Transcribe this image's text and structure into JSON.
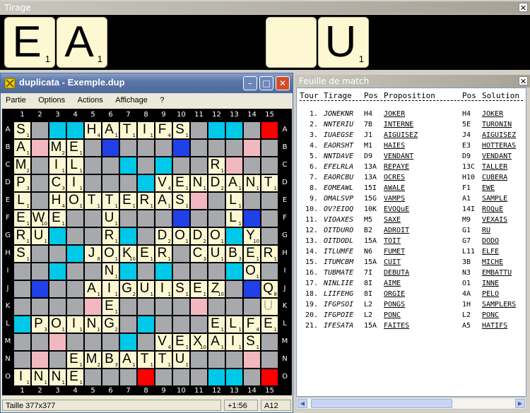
{
  "rack": {
    "title": "Tirage",
    "close": "✕",
    "tiles": [
      {
        "letter": "E",
        "value": "1"
      },
      {
        "letter": "A",
        "value": "1"
      },
      {
        "letter": "",
        "value": ""
      },
      {
        "letter": "",
        "value": ""
      },
      {
        "letter": "",
        "value": ""
      },
      {
        "letter": "",
        "value": ""
      },
      {
        "letter": "U",
        "value": "1"
      }
    ]
  },
  "duplicata": {
    "title": "duplicata - Exemple.dup",
    "buttons": {
      "minimize": "–",
      "maximize": "□",
      "close": "✕"
    },
    "menu": [
      "Partie",
      "Options",
      "Actions",
      "Affichage",
      "?"
    ],
    "columns": [
      "1",
      "2",
      "3",
      "4",
      "5",
      "6",
      "7",
      "8",
      "9",
      "10",
      "11",
      "12",
      "13",
      "14",
      "15"
    ],
    "rows": [
      "A",
      "B",
      "C",
      "D",
      "E",
      "F",
      "G",
      "H",
      "I",
      "J",
      "K",
      "L",
      "M",
      "N",
      "O"
    ],
    "board": [
      "S...HATIFS.....",
      "A.ME...........",
      "M.IL.......R...",
      "P.CI....VENDANT",
      "L.HOTTERAS..L..",
      "EWE..U......L..",
      "RU...R..DODO.Y.",
      "S...JOKER.CUBERA",
      ".....N.......O.",
      "....AIGUISEZ..Q",
      ".....E........u",
      ".POING.....ELFE",
      "........VEXAIS.",
      "...EMBATTU.....",
      "INNE..........."
    ],
    "status": {
      "size": "Taille 377x377",
      "time": "+1:56",
      "pos": "A12"
    }
  },
  "match": {
    "title": "Feuille de match",
    "close": "✕",
    "headers": {
      "tour": "Tour",
      "tirage": "Tirage",
      "pos": "Pos",
      "proposition": "Proposition",
      "pos2": "Pos",
      "solution": "Solution"
    },
    "rows": [
      {
        "n": "1.",
        "tirage": "JONEKNR",
        "pos": "H4",
        "prop": "JOKER",
        "pos2": "H4",
        "sol": "JOKER"
      },
      {
        "n": "2.",
        "tirage": "NNTERIU",
        "pos": "7B",
        "prop": "INTERNE",
        "pos2": "5E",
        "sol": "TURONIN"
      },
      {
        "n": "3.",
        "tirage": "IUAEGSE",
        "pos": "J1",
        "prop": "AIGUISEZ",
        "pos2": "J4",
        "sol": "AIGUISEZ"
      },
      {
        "n": "4.",
        "tirage": "EAORSHT",
        "pos": "M1",
        "prop": "HAIES",
        "pos2": "E3",
        "sol": "HOTTERAS"
      },
      {
        "n": "5.",
        "tirage": "NNTDAVE",
        "pos": "D9",
        "prop": "VENDANT",
        "pos2": "D9",
        "sol": "VENDANT"
      },
      {
        "n": "6.",
        "tirage": "EFELRLA",
        "pos": "13A",
        "prop": "REPAYE",
        "pos2": "13C",
        "sol": "TALLER"
      },
      {
        "n": "7.",
        "tirage": "EAORCBU",
        "pos": "13A",
        "prop": "OCRES",
        "pos2": "H10",
        "sol": "CUBERA"
      },
      {
        "n": "8.",
        "tirage": "EOMEAWL",
        "pos": "15I",
        "prop": "AWALE",
        "pos2": "F1",
        "sol": "EWE"
      },
      {
        "n": "9.",
        "tirage": "OMALSVP",
        "pos": "15G",
        "prop": "VAMPS",
        "pos2": "A1",
        "sol": "SAMPLE"
      },
      {
        "n": "10.",
        "tirage": "OV?EIOQ",
        "pos": "10K",
        "prop": "EVOQuE",
        "pos2": "14I",
        "sol": "ROQuE"
      },
      {
        "n": "11.",
        "tirage": "VIOAXES",
        "pos": "M5",
        "prop": "SAXE",
        "pos2": "M9",
        "sol": "VEXAIS"
      },
      {
        "n": "12.",
        "tirage": "OITDURO",
        "pos": "B2",
        "prop": "ADROIT",
        "pos2": "G1",
        "sol": "RU"
      },
      {
        "n": "13.",
        "tirage": "OITDODL",
        "pos": "15A",
        "prop": "TOIT",
        "pos2": "G7",
        "sol": "DODO"
      },
      {
        "n": "14.",
        "tirage": "ITLUMFE",
        "pos": "N6",
        "prop": "FUMET",
        "pos2": "L11",
        "sol": "ELFE"
      },
      {
        "n": "15.",
        "tirage": "ITUMCBM",
        "pos": "15A",
        "prop": "CUIT",
        "pos2": "3B",
        "sol": "MICHE"
      },
      {
        "n": "16.",
        "tirage": "TUBMATE",
        "pos": "7I",
        "prop": "DEBUTA",
        "pos2": "N3",
        "sol": "EMBATTU"
      },
      {
        "n": "17.",
        "tirage": "NINLIIE",
        "pos": "8I",
        "prop": "AIME",
        "pos2": "O1",
        "sol": "INNE"
      },
      {
        "n": "18.",
        "tirage": "LIIFEHG",
        "pos": "8I",
        "prop": "ORGIE",
        "pos2": "4A",
        "sol": "PELO"
      },
      {
        "n": "19.",
        "tirage": "IFGPSOI",
        "pos": "L2",
        "prop": "PONGS",
        "pos2": "1H",
        "sol": "SAMPLERS"
      },
      {
        "n": "20.",
        "tirage": "IFGPOIE",
        "pos": "L2",
        "prop": "PONC",
        "pos2": "L2",
        "sol": "PONC"
      },
      {
        "n": "21.",
        "tirage": "IFESATA",
        "pos": "15A",
        "prop": "FAITES",
        "pos2": "A5",
        "sol": "HATIFS"
      }
    ]
  }
}
